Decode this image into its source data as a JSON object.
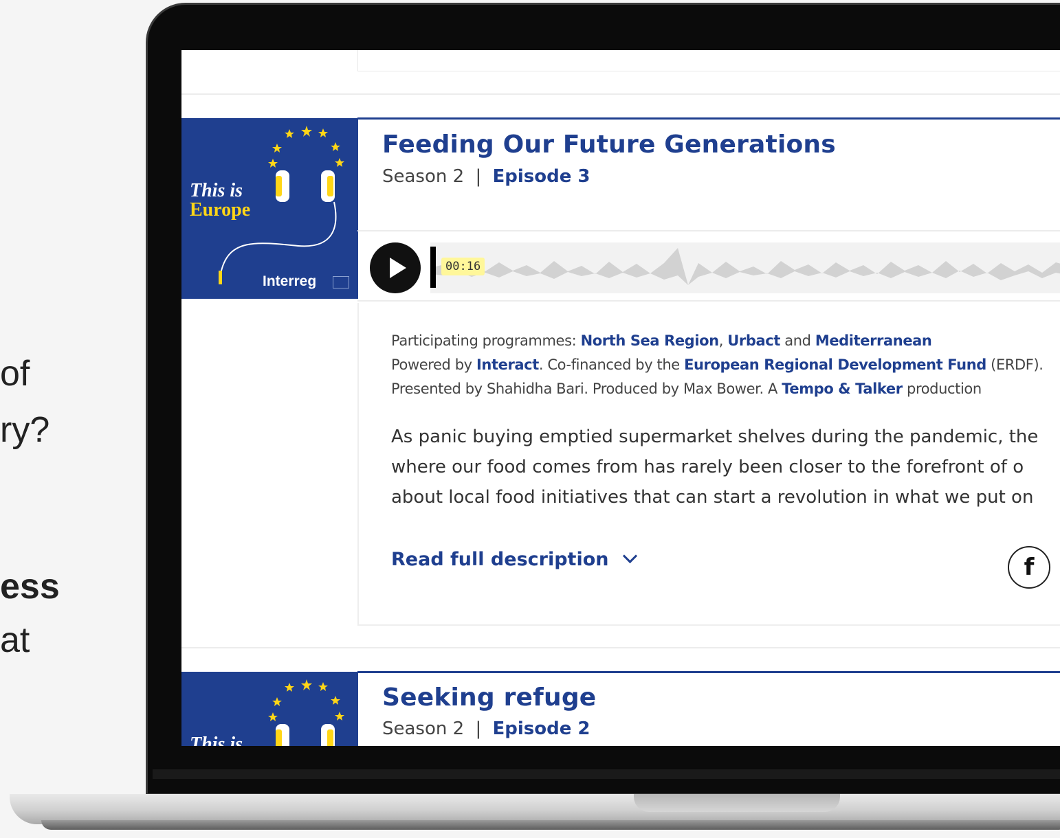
{
  "slide_text": {
    "line1": "of",
    "line2": "ry?",
    "line3": "ess",
    "line4": "at"
  },
  "episodes": [
    {
      "art_title_line1": "This is",
      "art_title_line2": "Europe",
      "art_brand": "Interreg",
      "title": "Feeding Our Future Generations",
      "season": "Season 2",
      "separator": "|",
      "episode": "Episode 3",
      "player": {
        "time": "00:16",
        "play_icon": "play-icon"
      },
      "credits": {
        "line1_prefix": "Participating programmes: ",
        "prog1": "North Sea Region",
        "comma": ", ",
        "prog2": "Urbact",
        "and": " and ",
        "prog3": "Mediterranean",
        "line2_prefix": "Powered by ",
        "interact": "Interact",
        "line2_mid": ". Co-financed by the ",
        "erdf": "European Regional Development Fund",
        "line2_suffix": " (ERDF).",
        "line3_prefix": "Presented by Shahidha Bari. Produced by Max Bower. A ",
        "producer": "Tempo & Talker",
        "line3_suffix": " production"
      },
      "summary": [
        "As panic buying emptied supermarket shelves during the pandemic, the",
        "where our food comes from has rarely been closer to the forefront of o",
        "about local food initiatives that can start a revolution in what we put on"
      ],
      "read_more": "Read full description",
      "share_icon": "facebook-icon",
      "share_glyph": "f"
    },
    {
      "art_title_line1": "This is",
      "title": "Seeking refuge",
      "season": "Season 2",
      "separator": "|",
      "episode": "Episode 2"
    }
  ],
  "colors": {
    "brand_blue": "#1f3f8f",
    "star_yellow": "#ffd617",
    "time_highlight": "#fff79a"
  }
}
